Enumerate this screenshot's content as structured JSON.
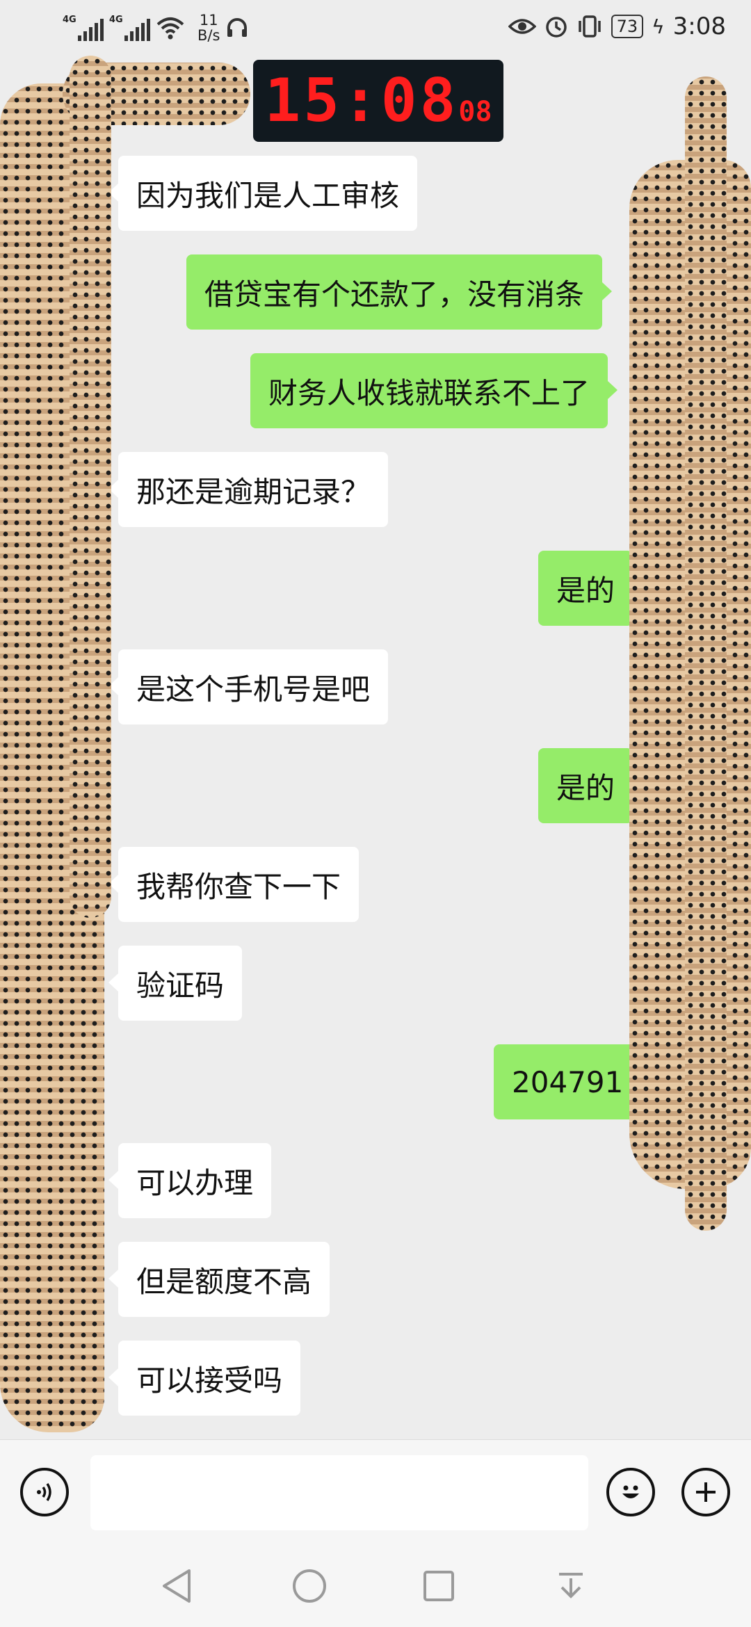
{
  "status_bar": {
    "signal1_tag": "4G",
    "signal2_tag": "4G",
    "net_speed_value": "11",
    "net_speed_unit": "B/s",
    "battery": "73",
    "time": "3:08"
  },
  "clock_overlay": {
    "time": "15:08",
    "seconds": "08"
  },
  "messages": [
    {
      "side": "left",
      "text": "因为我们是人工审核"
    },
    {
      "side": "right",
      "text": "借贷宝有个还款了，没有消条"
    },
    {
      "side": "right",
      "text": "财务人收钱就联系不上了"
    },
    {
      "side": "left",
      "text": "那还是逾期记录？"
    },
    {
      "side": "right",
      "text": "是的"
    },
    {
      "side": "left",
      "text": "是这个手机号是吧"
    },
    {
      "side": "right",
      "text": "是的"
    },
    {
      "side": "left",
      "text": "我帮你查下一下"
    },
    {
      "side": "left",
      "text": "验证码"
    },
    {
      "side": "right",
      "text": "204791"
    },
    {
      "side": "left",
      "text": "可以办理"
    },
    {
      "side": "left",
      "text": "但是额度不高"
    },
    {
      "side": "left",
      "text": "可以接受吗"
    }
  ],
  "input_bar": {
    "voice_icon": "voice-icon",
    "emoji_icon": "emoji-icon",
    "plus_icon": "plus-icon",
    "input_value": ""
  },
  "colors": {
    "background": "#ededed",
    "incoming_bubble": "#ffffff",
    "outgoing_bubble": "#95ec69",
    "clock_digits": "#ff1e1e"
  }
}
